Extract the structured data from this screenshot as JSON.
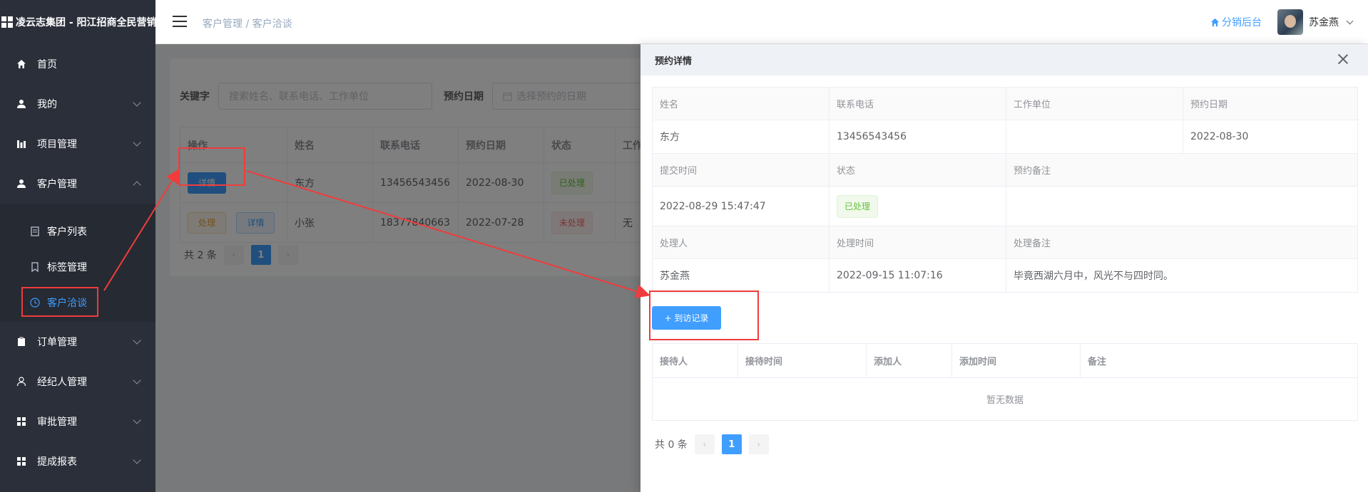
{
  "app": {
    "title": "凌云志集团 - 阳江招商全民营销"
  },
  "sidebar": {
    "items": [
      {
        "label": "首页",
        "icon": "home-icon"
      },
      {
        "label": "我的",
        "icon": "user-icon"
      },
      {
        "label": "项目管理",
        "icon": "chart-icon"
      },
      {
        "label": "客户管理",
        "icon": "user-icon"
      }
    ],
    "sub_items": [
      {
        "label": "客户列表",
        "icon": "document-icon"
      },
      {
        "label": "标签管理",
        "icon": "bookmark-icon"
      },
      {
        "label": "客户洽谈",
        "icon": "clock-icon"
      }
    ],
    "items_after": [
      {
        "label": "订单管理",
        "icon": "clipboard-icon"
      },
      {
        "label": "经纪人管理",
        "icon": "person-icon"
      },
      {
        "label": "审批管理",
        "icon": "grid-icon"
      },
      {
        "label": "提成报表",
        "icon": "grid-icon"
      }
    ]
  },
  "header": {
    "breadcrumb_parent": "客户管理",
    "breadcrumb_sep": "/",
    "breadcrumb_current": "客户洽谈",
    "dist_link": "分销后台",
    "username": "苏金燕"
  },
  "search": {
    "keyword_label": "关键字",
    "keyword_placeholder": "搜索姓名、联系电话、工作单位",
    "date_label": "预约日期",
    "date_placeholder": "选择预约的日期"
  },
  "table": {
    "headers": [
      "操作",
      "姓名",
      "联系电话",
      "预约日期",
      "状态",
      "工作"
    ],
    "rows": [
      {
        "actions": [
          "详情"
        ],
        "name": "东方",
        "phone": "13456543456",
        "date": "2022-08-30",
        "status": "已处理",
        "work": ""
      },
      {
        "actions": [
          "处理",
          "详情"
        ],
        "name": "小张",
        "phone": "18377840663",
        "date": "2022-07-28",
        "status": "未处理",
        "work": "无"
      }
    ],
    "pager": {
      "total": "共 2 条",
      "page": "1",
      "prev": "‹",
      "next": "›"
    }
  },
  "drawer": {
    "title": "预约详情",
    "labels1": [
      "姓名",
      "联系电话",
      "工作单位",
      "预约日期"
    ],
    "values1": [
      "东方",
      "13456543456",
      "",
      "2022-08-30"
    ],
    "labels2": [
      "提交时间",
      "状态",
      "预约备注"
    ],
    "values2": [
      "2022-08-29 15:47:47",
      "已处理",
      ""
    ],
    "labels3": [
      "处理人",
      "处理时间",
      "处理备注"
    ],
    "values3": [
      "苏金燕",
      "2022-09-15 11:07:16",
      "毕竟西湖六月中，风光不与四时同。"
    ],
    "add_button": "+ 到访记录",
    "records": {
      "headers": [
        "接待人",
        "接待时间",
        "添加人",
        "添加时间",
        "备注"
      ],
      "empty": "暂无数据"
    },
    "pager": {
      "total": "共 0 条",
      "page": "1",
      "prev": "‹",
      "next": "›"
    }
  },
  "colors": {
    "primary": "#409eff",
    "annotation": "#f03c3c",
    "sidebar": "#2b2f3a"
  }
}
